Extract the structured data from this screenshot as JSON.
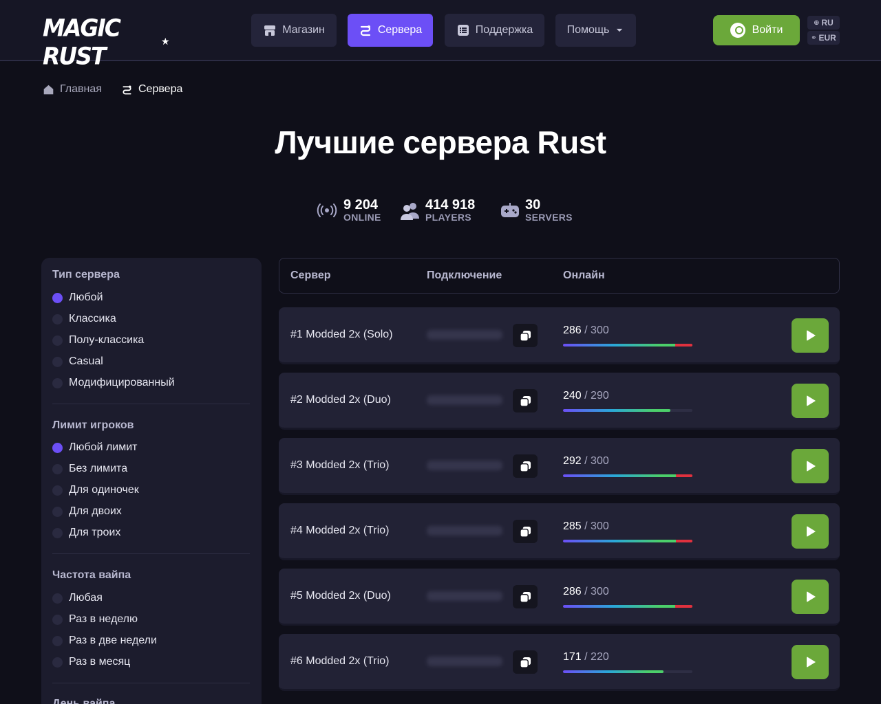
{
  "header": {
    "logo_text": "MAGIC RUST",
    "nav": [
      {
        "label": "Магазин",
        "icon": "store-icon"
      },
      {
        "label": "Сервера",
        "icon": "servers-icon",
        "active": true
      },
      {
        "label": "Поддержка",
        "icon": "support-list-icon"
      },
      {
        "label": "Помощь",
        "icon": "chevron-down-icon"
      }
    ],
    "login_label": "Войти",
    "lang": "RU",
    "currency": "EUR"
  },
  "breadcrumb": {
    "home": "Главная",
    "current": "Сервера"
  },
  "title": "Лучшие сервера Rust",
  "stats": [
    {
      "value": "9 204",
      "label": "ONLINE",
      "icon": "broadcast-icon"
    },
    {
      "value": "414 918",
      "label": "PLAYERS",
      "icon": "players-icon"
    },
    {
      "value": "30",
      "label": "SERVERS",
      "icon": "gamepad-icon"
    }
  ],
  "filters": {
    "server_type": {
      "title": "Тип сервера",
      "options": [
        "Любой",
        "Классика",
        "Полу-классика",
        "Casual",
        "Модифицированный"
      ],
      "selected": 0
    },
    "player_limit": {
      "title": "Лимит игроков",
      "options": [
        "Любой лимит",
        "Без лимита",
        "Для одиночек",
        "Для двоих",
        "Для троих"
      ],
      "selected": 0
    },
    "wipe_freq": {
      "title": "Частота вайпа",
      "options": [
        "Любая",
        "Раз в неделю",
        "Раз в две недели",
        "Раз в месяц"
      ],
      "selected": null
    },
    "wipe_day": {
      "title": "День вайпа"
    }
  },
  "table": {
    "headers": [
      "Сервер",
      "Подключение",
      "Онлайн"
    ],
    "rows": [
      {
        "name": "#1 Modded 2x (Solo)",
        "online": 286,
        "max": 300,
        "online_text": "286",
        "max_text": "/ 300"
      },
      {
        "name": "#2 Modded 2x (Duo)",
        "online": 240,
        "max": 290,
        "online_text": "240",
        "max_text": "/ 290"
      },
      {
        "name": "#3 Modded 2x (Trio)",
        "online": 292,
        "max": 300,
        "online_text": "292",
        "max_text": "/ 300"
      },
      {
        "name": "#4 Modded 2x (Trio)",
        "online": 285,
        "max": 300,
        "online_text": "285",
        "max_text": "/ 300"
      },
      {
        "name": "#5 Modded 2x (Duo)",
        "online": 286,
        "max": 300,
        "online_text": "286",
        "max_text": "/ 300"
      },
      {
        "name": "#6 Modded 2x (Trio)",
        "online": 171,
        "max": 220,
        "online_text": "171",
        "max_text": "/ 220"
      }
    ]
  },
  "colors": {
    "accent": "#6c4ff6",
    "green": "#6ba83a",
    "bg": "#0f0f19",
    "panel": "#1c1c2d",
    "row": "#222235",
    "bar_red": "#e0313e"
  }
}
